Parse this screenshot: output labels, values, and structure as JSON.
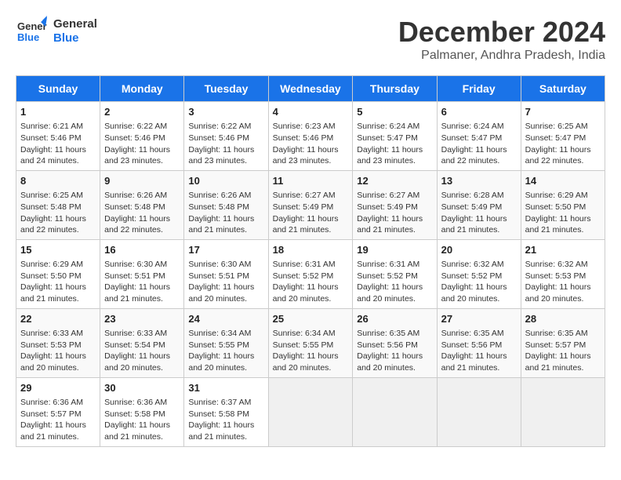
{
  "header": {
    "logo_line1": "General",
    "logo_line2": "Blue",
    "month": "December 2024",
    "location": "Palmaner, Andhra Pradesh, India"
  },
  "weekdays": [
    "Sunday",
    "Monday",
    "Tuesday",
    "Wednesday",
    "Thursday",
    "Friday",
    "Saturday"
  ],
  "weeks": [
    [
      {
        "day": "1",
        "text": "Sunrise: 6:21 AM\nSunset: 5:46 PM\nDaylight: 11 hours\nand 24 minutes."
      },
      {
        "day": "2",
        "text": "Sunrise: 6:22 AM\nSunset: 5:46 PM\nDaylight: 11 hours\nand 23 minutes."
      },
      {
        "day": "3",
        "text": "Sunrise: 6:22 AM\nSunset: 5:46 PM\nDaylight: 11 hours\nand 23 minutes."
      },
      {
        "day": "4",
        "text": "Sunrise: 6:23 AM\nSunset: 5:46 PM\nDaylight: 11 hours\nand 23 minutes."
      },
      {
        "day": "5",
        "text": "Sunrise: 6:24 AM\nSunset: 5:47 PM\nDaylight: 11 hours\nand 23 minutes."
      },
      {
        "day": "6",
        "text": "Sunrise: 6:24 AM\nSunset: 5:47 PM\nDaylight: 11 hours\nand 22 minutes."
      },
      {
        "day": "7",
        "text": "Sunrise: 6:25 AM\nSunset: 5:47 PM\nDaylight: 11 hours\nand 22 minutes."
      }
    ],
    [
      {
        "day": "8",
        "text": "Sunrise: 6:25 AM\nSunset: 5:48 PM\nDaylight: 11 hours\nand 22 minutes."
      },
      {
        "day": "9",
        "text": "Sunrise: 6:26 AM\nSunset: 5:48 PM\nDaylight: 11 hours\nand 22 minutes."
      },
      {
        "day": "10",
        "text": "Sunrise: 6:26 AM\nSunset: 5:48 PM\nDaylight: 11 hours\nand 21 minutes."
      },
      {
        "day": "11",
        "text": "Sunrise: 6:27 AM\nSunset: 5:49 PM\nDaylight: 11 hours\nand 21 minutes."
      },
      {
        "day": "12",
        "text": "Sunrise: 6:27 AM\nSunset: 5:49 PM\nDaylight: 11 hours\nand 21 minutes."
      },
      {
        "day": "13",
        "text": "Sunrise: 6:28 AM\nSunset: 5:49 PM\nDaylight: 11 hours\nand 21 minutes."
      },
      {
        "day": "14",
        "text": "Sunrise: 6:29 AM\nSunset: 5:50 PM\nDaylight: 11 hours\nand 21 minutes."
      }
    ],
    [
      {
        "day": "15",
        "text": "Sunrise: 6:29 AM\nSunset: 5:50 PM\nDaylight: 11 hours\nand 21 minutes."
      },
      {
        "day": "16",
        "text": "Sunrise: 6:30 AM\nSunset: 5:51 PM\nDaylight: 11 hours\nand 21 minutes."
      },
      {
        "day": "17",
        "text": "Sunrise: 6:30 AM\nSunset: 5:51 PM\nDaylight: 11 hours\nand 20 minutes."
      },
      {
        "day": "18",
        "text": "Sunrise: 6:31 AM\nSunset: 5:52 PM\nDaylight: 11 hours\nand 20 minutes."
      },
      {
        "day": "19",
        "text": "Sunrise: 6:31 AM\nSunset: 5:52 PM\nDaylight: 11 hours\nand 20 minutes."
      },
      {
        "day": "20",
        "text": "Sunrise: 6:32 AM\nSunset: 5:52 PM\nDaylight: 11 hours\nand 20 minutes."
      },
      {
        "day": "21",
        "text": "Sunrise: 6:32 AM\nSunset: 5:53 PM\nDaylight: 11 hours\nand 20 minutes."
      }
    ],
    [
      {
        "day": "22",
        "text": "Sunrise: 6:33 AM\nSunset: 5:53 PM\nDaylight: 11 hours\nand 20 minutes."
      },
      {
        "day": "23",
        "text": "Sunrise: 6:33 AM\nSunset: 5:54 PM\nDaylight: 11 hours\nand 20 minutes."
      },
      {
        "day": "24",
        "text": "Sunrise: 6:34 AM\nSunset: 5:55 PM\nDaylight: 11 hours\nand 20 minutes."
      },
      {
        "day": "25",
        "text": "Sunrise: 6:34 AM\nSunset: 5:55 PM\nDaylight: 11 hours\nand 20 minutes."
      },
      {
        "day": "26",
        "text": "Sunrise: 6:35 AM\nSunset: 5:56 PM\nDaylight: 11 hours\nand 20 minutes."
      },
      {
        "day": "27",
        "text": "Sunrise: 6:35 AM\nSunset: 5:56 PM\nDaylight: 11 hours\nand 21 minutes."
      },
      {
        "day": "28",
        "text": "Sunrise: 6:35 AM\nSunset: 5:57 PM\nDaylight: 11 hours\nand 21 minutes."
      }
    ],
    [
      {
        "day": "29",
        "text": "Sunrise: 6:36 AM\nSunset: 5:57 PM\nDaylight: 11 hours\nand 21 minutes."
      },
      {
        "day": "30",
        "text": "Sunrise: 6:36 AM\nSunset: 5:58 PM\nDaylight: 11 hours\nand 21 minutes."
      },
      {
        "day": "31",
        "text": "Sunrise: 6:37 AM\nSunset: 5:58 PM\nDaylight: 11 hours\nand 21 minutes."
      },
      {
        "day": "",
        "text": ""
      },
      {
        "day": "",
        "text": ""
      },
      {
        "day": "",
        "text": ""
      },
      {
        "day": "",
        "text": ""
      }
    ]
  ]
}
